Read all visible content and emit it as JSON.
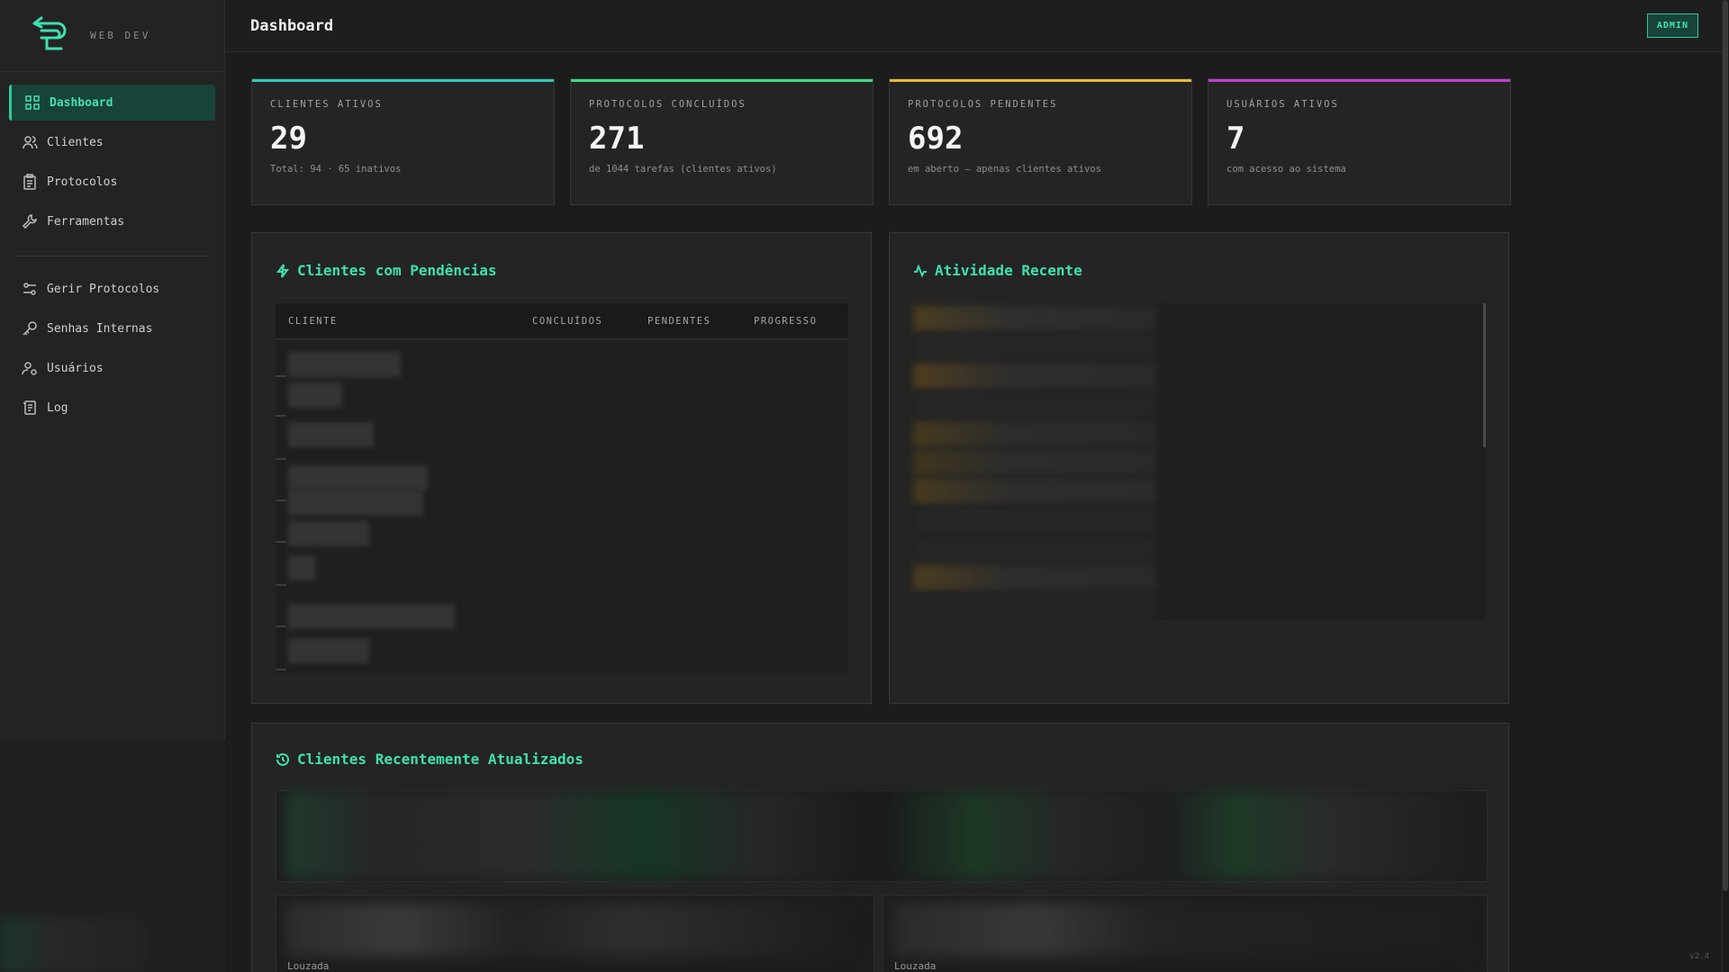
{
  "sidebar": {
    "brand_text": "WEB DEV",
    "items": [
      {
        "label": "Dashboard",
        "icon": "grid-icon"
      },
      {
        "label": "Clientes",
        "icon": "users-icon"
      },
      {
        "label": "Protocolos",
        "icon": "clipboard-icon"
      },
      {
        "label": "Ferramentas",
        "icon": "wrench-icon"
      }
    ],
    "admin_items": [
      {
        "label": "Gerir Protocolos",
        "icon": "sliders-icon"
      },
      {
        "label": "Senhas Internas",
        "icon": "key-icon"
      },
      {
        "label": "Usuários",
        "icon": "user-gear-icon"
      },
      {
        "label": "Log",
        "icon": "scroll-icon"
      }
    ]
  },
  "header": {
    "title": "Dashboard",
    "badge": "ADMIN"
  },
  "stats": [
    {
      "label": "CLIENTES ATIVOS",
      "value": "29",
      "sub": "Total: 94 · 65 inativos",
      "accent": "#2ec9b3"
    },
    {
      "label": "PROTOCOLOS CONCLUÍDOS",
      "value": "271",
      "sub": "de 1044 tarefas (clientes ativos)",
      "accent": "#3ddc84"
    },
    {
      "label": "PROTOCOLOS PENDENTES",
      "value": "692",
      "sub": "em aberto — apenas clientes ativos",
      "accent": "#e8b93a"
    },
    {
      "label": "USUÁRIOS ATIVOS",
      "value": "7",
      "sub": "com acesso ao sistema",
      "accent": "#c23fd6"
    }
  ],
  "pendencias": {
    "title": "Clientes com Pendências",
    "columns": [
      "CLIENTE",
      "CONCLUÍDOS",
      "PENDENTES",
      "PROGRESSO"
    ]
  },
  "atividade": {
    "title": "Atividade Recente"
  },
  "recentes": {
    "title": "Clientes Recentemente Atualizados",
    "card_labels": [
      "Louzada",
      "Louzada"
    ]
  },
  "footer": {
    "version": "v2.4"
  },
  "colors": {
    "accent": "#3fe0b0",
    "background": "#1c1c1c",
    "panel": "#242424"
  }
}
